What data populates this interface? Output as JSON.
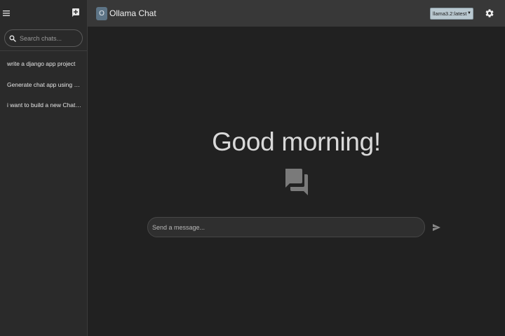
{
  "header": {
    "logo_letter": "O",
    "title": "Ollama Chat",
    "model_selected": "llama3.2:latest"
  },
  "sidebar": {
    "search": {
      "placeholder": "Search chats..."
    },
    "chats": [
      {
        "title": "write a django app project"
      },
      {
        "title": "Generate chat app using Nextjs"
      },
      {
        "title": "i want to build a new ChatGPT clone"
      }
    ]
  },
  "main": {
    "greeting": "Good morning!",
    "message_input": {
      "placeholder": "Send a message..."
    }
  },
  "icons": {
    "menu": "menu-icon",
    "new_chat": "new-chat-icon",
    "search": "search-icon",
    "settings": "gear-icon",
    "chat_bubbles": "chat-bubbles-icon",
    "send": "send-icon"
  },
  "colors": {
    "background": "#212121",
    "sidebar": "#2a2a2a",
    "topbar": "#383838",
    "logo_badge": "#5d7486",
    "model_select": "#b9c8d0",
    "text_primary": "#d9d9d9",
    "icon_muted": "#7a7a7a"
  }
}
